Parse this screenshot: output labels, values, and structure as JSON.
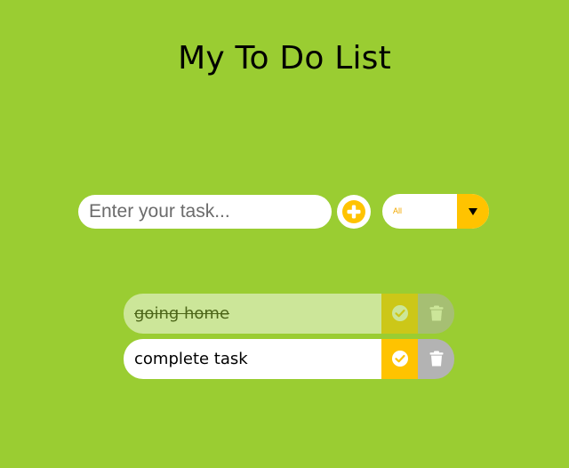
{
  "app": {
    "title": "My To Do List"
  },
  "input": {
    "placeholder": "Enter your task...",
    "value": ""
  },
  "add_button": {
    "icon": "plus-circle-icon"
  },
  "filter": {
    "selected": "All",
    "icon": "dropdown-arrow-icon"
  },
  "todos": [
    {
      "text": "going home",
      "completed": true,
      "check_icon": "check-circle-icon",
      "trash_icon": "trash-icon"
    },
    {
      "text": "complete task",
      "completed": false,
      "check_icon": "check-circle-icon",
      "trash_icon": "trash-icon"
    }
  ],
  "colors": {
    "background": "#9acd32",
    "accent": "#ffc300",
    "trash": "#b3b3b3",
    "surface": "#ffffff"
  }
}
